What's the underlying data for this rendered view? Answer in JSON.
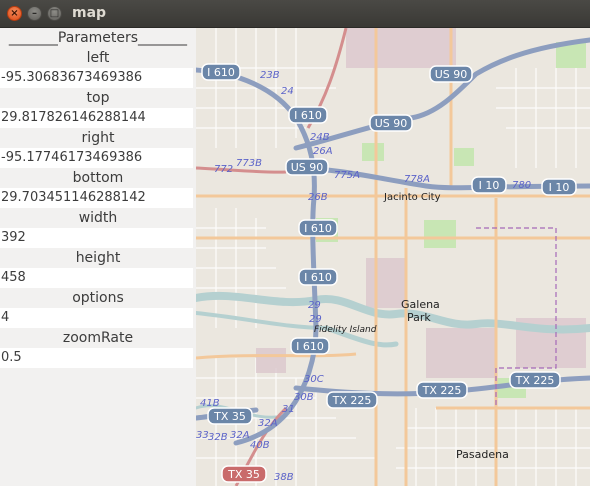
{
  "window": {
    "title": "map",
    "close_glyph": "×",
    "minimize_glyph": "–",
    "maximize_glyph": "□"
  },
  "panel": {
    "heading": "_______Parameters_______",
    "params": [
      {
        "label": "left",
        "value": "-95.30683673469386"
      },
      {
        "label": "top",
        "value": "29.817826146288144"
      },
      {
        "label": "right",
        "value": "-95.17746173469386"
      },
      {
        "label": "bottom",
        "value": "29.703451146288142"
      },
      {
        "label": "width",
        "value": "392"
      },
      {
        "label": "height",
        "value": "458"
      },
      {
        "label": "options",
        "value": "4"
      },
      {
        "label": "zoomRate",
        "value": "0.5"
      }
    ]
  },
  "map": {
    "shields": [
      "I 610",
      "US 90",
      "I 610",
      "US 90",
      "US 90",
      "I 610",
      "I 610",
      "I 10",
      "I 10",
      "I 610",
      "TX 225",
      "TX 225",
      "TX 225",
      "TX 35",
      "TX 35"
    ],
    "exits": [
      "23B",
      "24",
      "24B",
      "26A",
      "773B",
      "772",
      "775A",
      "26B",
      "778A",
      "780",
      "29",
      "29",
      "30C",
      "30B",
      "31",
      "32A",
      "32A",
      "32B",
      "33",
      "40B",
      "41B",
      "38B"
    ],
    "places": {
      "jacinto_city": "Jacinto City",
      "galena": "Galena",
      "park": "Park",
      "fidelity": "Fidelity Island",
      "pasadena": "Pasadena"
    },
    "colors": {
      "interstate_shield": "#6b86a8",
      "state_shield": "#c96b6b",
      "water": "#b5d0d0",
      "park": "#c8e6b4",
      "industrial": "#dcc7cd",
      "motorway": "#8d9ebf",
      "trunk": "#d48e8e",
      "primary": "#f3c89a"
    }
  }
}
